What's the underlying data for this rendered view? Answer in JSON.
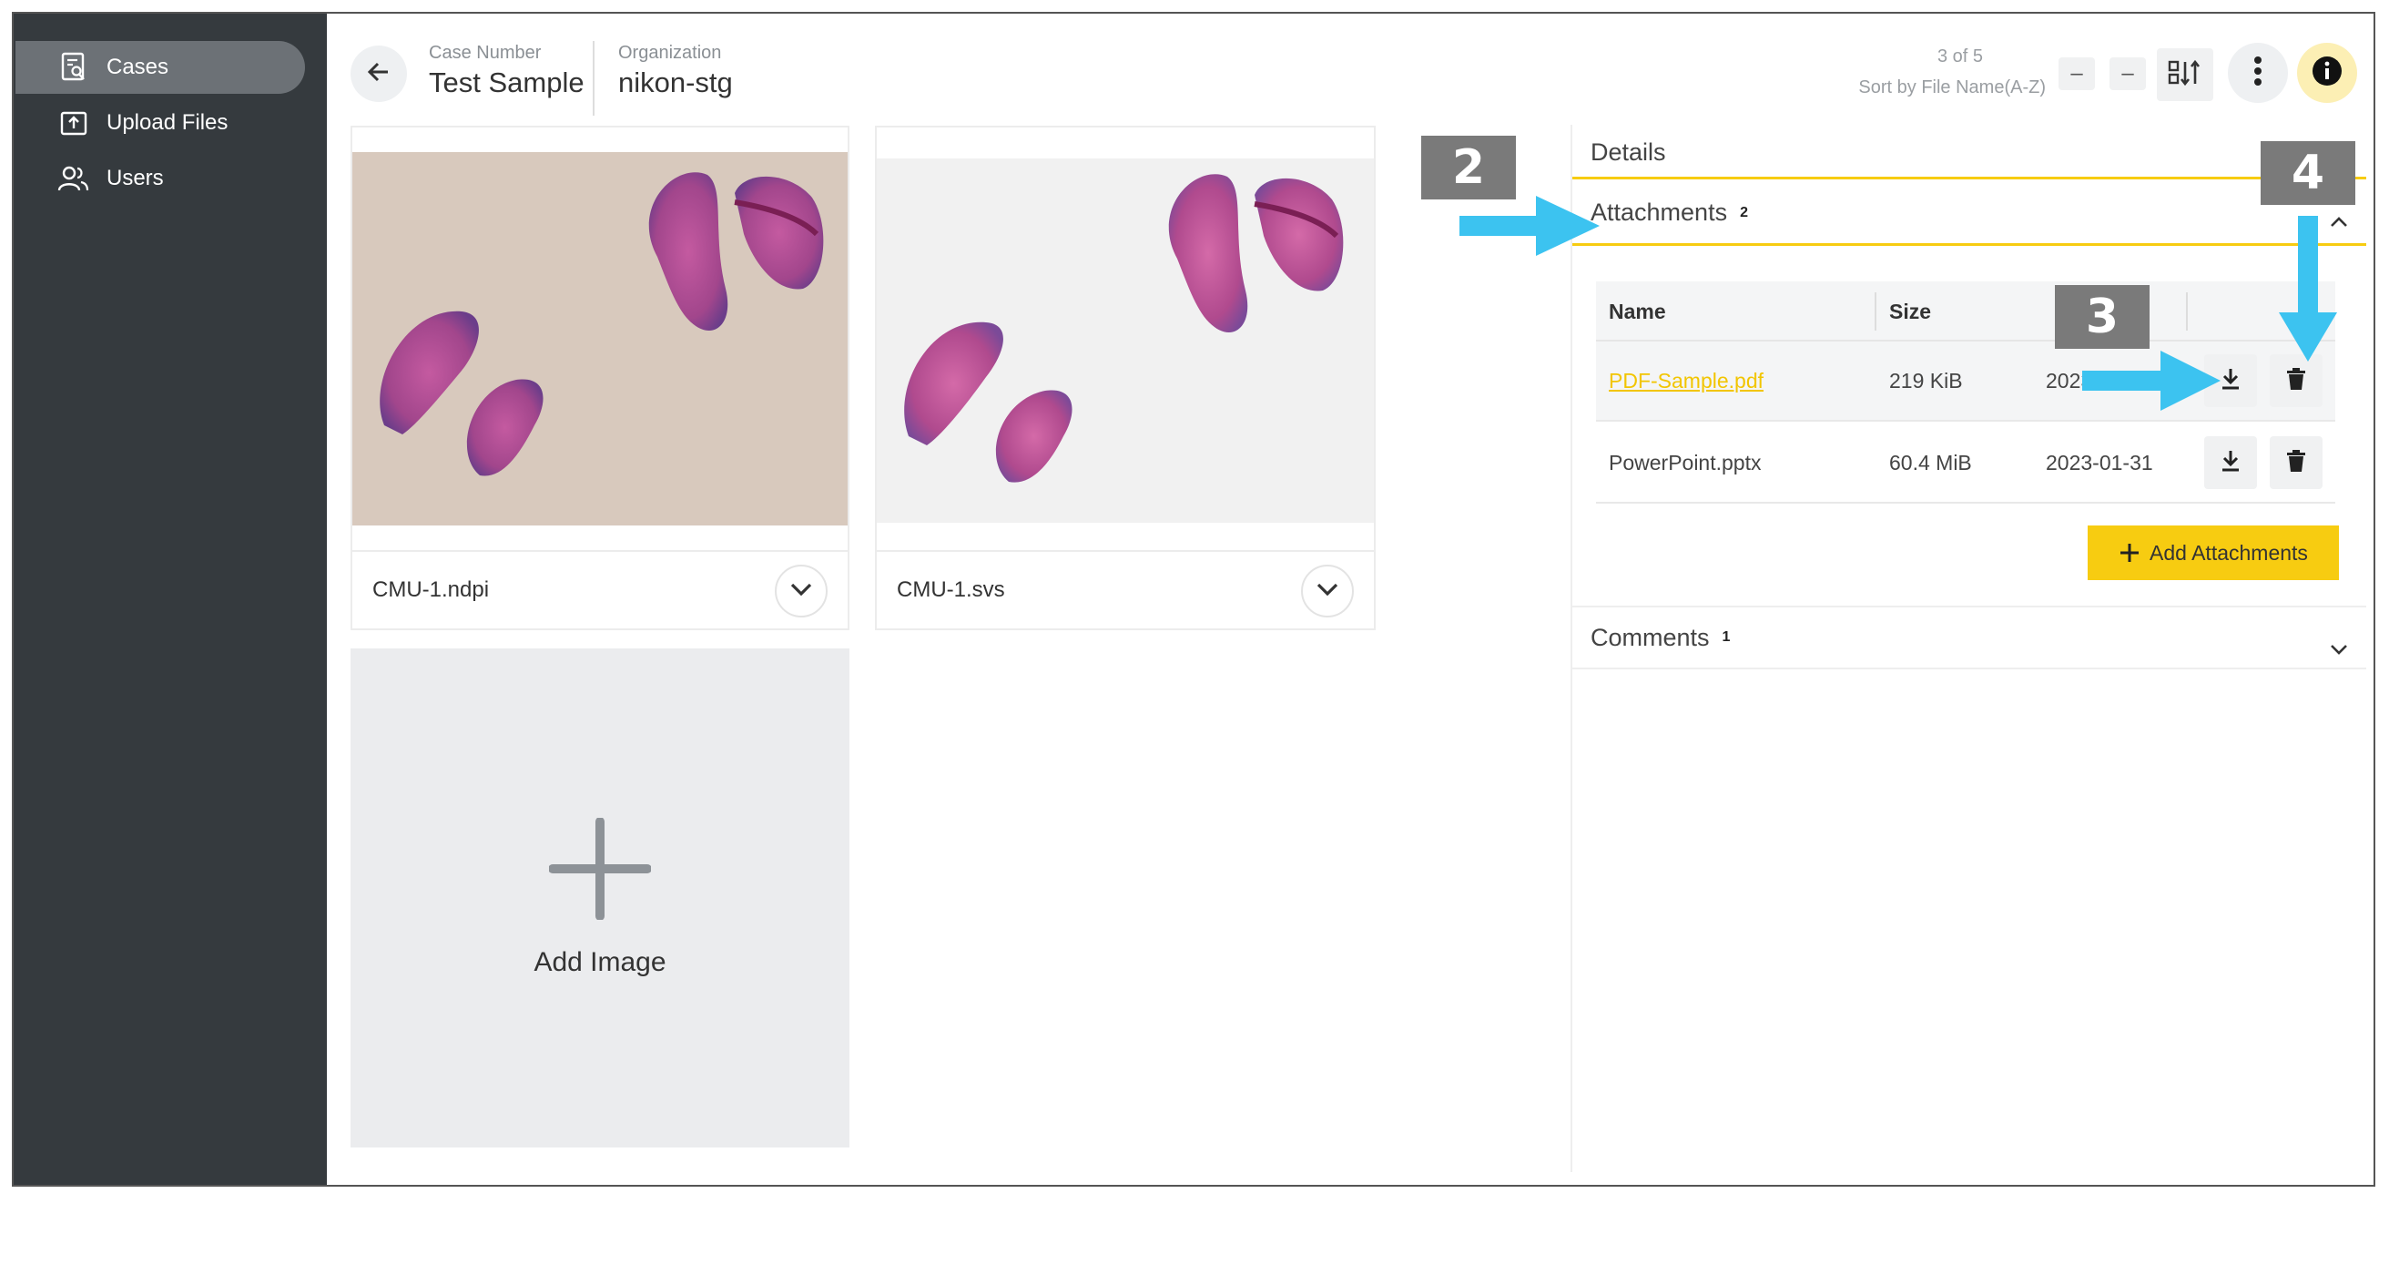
{
  "sidebar": {
    "items": [
      {
        "label": "Cases",
        "icon": "cases-icon",
        "active": true
      },
      {
        "label": "Upload Files",
        "icon": "upload-icon",
        "active": false
      },
      {
        "label": "Users",
        "icon": "users-icon",
        "active": false
      }
    ]
  },
  "header": {
    "case_number_label": "Case Number",
    "case_number_value": "Test Sample",
    "organization_label": "Organization",
    "organization_value": "nikon-stg",
    "pager_count": "3 of 5",
    "sort_label": "Sort by File Name(A-Z)",
    "prev_label": "–",
    "next_label": "–"
  },
  "images": [
    {
      "file_name": "CMU-1.ndpi"
    },
    {
      "file_name": "CMU-1.svs"
    }
  ],
  "add_image_label": "Add Image",
  "panel": {
    "details_label": "Details",
    "attachments_label": "Attachments",
    "attachments_count": "2",
    "columns": {
      "name": "Name",
      "size": "Size"
    },
    "attachments": [
      {
        "name": "PDF-Sample.pdf",
        "size": "219 KiB",
        "date": "2023-01-31"
      },
      {
        "name": "PowerPoint.pptx",
        "size": "60.4 MiB",
        "date": "2023-01-31"
      }
    ],
    "add_attachments_label": "Add Attachments",
    "comments_label": "Comments",
    "comments_count": "1"
  },
  "annotations": [
    "2",
    "3",
    "4"
  ],
  "colors": {
    "sidebar_bg": "#353a3e",
    "accent_yellow": "#f7cc11",
    "annotation_arrow": "#3cc3f0",
    "annotation_tag": "#7a7a7a"
  }
}
